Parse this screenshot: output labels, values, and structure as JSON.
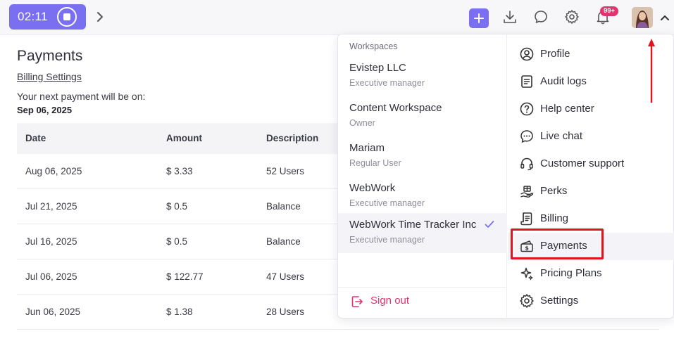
{
  "topbar": {
    "timer": "02:11",
    "notifications_badge": "99+",
    "accent": "#7a6ff0",
    "badge_color": "#e5316d",
    "icons": [
      "stop-icon",
      "chevron-right-icon",
      "plus-icon",
      "download-icon",
      "chat-icon",
      "gear-icon",
      "bell-icon",
      "avatar",
      "chevron-up-icon"
    ]
  },
  "page": {
    "title": "Payments",
    "billing_settings": "Billing Settings",
    "next_payment_label": "Your next payment will be on:",
    "next_payment_date": "Sep 06, 2025"
  },
  "table": {
    "headers": [
      "Date",
      "Amount",
      "Description"
    ],
    "rows": [
      [
        "Aug 06, 2025",
        "$ 3.33",
        "52 Users"
      ],
      [
        "Jul 21, 2025",
        "$ 0.5",
        "Balance"
      ],
      [
        "Jul 16, 2025",
        "$ 0.5",
        "Balance"
      ],
      [
        "Jul 06, 2025",
        "$ 122.77",
        "47 Users"
      ],
      [
        "Jun 06, 2025",
        "$ 1.38",
        "28 Users"
      ]
    ]
  },
  "dropdown": {
    "workspaces_header": "Workspaces",
    "workspaces": [
      {
        "name": "Evistep LLC",
        "role": "Executive manager"
      },
      {
        "name": "Content Workspace",
        "role": "Owner"
      },
      {
        "name": "Mariam",
        "role": "Regular User"
      },
      {
        "name": "WebWork",
        "role": "Executive manager"
      },
      {
        "name": "WebWork Time Tracker Inc",
        "role": "Executive manager",
        "selected": true
      }
    ],
    "sign_out": "Sign out",
    "menu": [
      {
        "label": "Profile",
        "icon": "user-circle-icon"
      },
      {
        "label": "Audit logs",
        "icon": "document-icon"
      },
      {
        "label": "Help center",
        "icon": "question-icon"
      },
      {
        "label": "Live chat",
        "icon": "chat-dots-icon"
      },
      {
        "label": "Customer support",
        "icon": "headset-icon"
      },
      {
        "label": "Perks",
        "icon": "gift-hand-icon"
      },
      {
        "label": "Billing",
        "icon": "receipt-icon"
      },
      {
        "label": "Payments",
        "icon": "wallet-icon",
        "active": true
      },
      {
        "label": "Pricing Plans",
        "icon": "sparkle-icon"
      },
      {
        "label": "Settings",
        "icon": "gear-icon"
      }
    ]
  },
  "annotation": {
    "highlight_color": "#e0141e"
  }
}
